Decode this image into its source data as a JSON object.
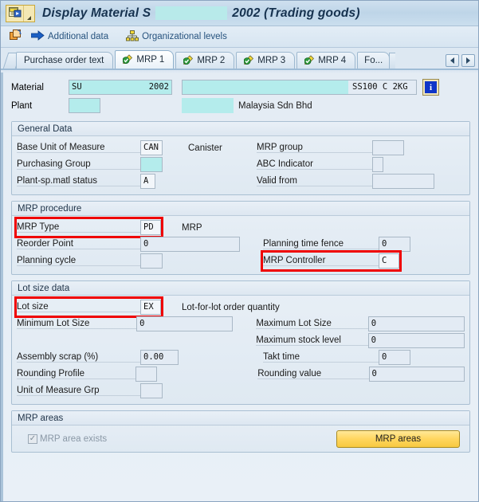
{
  "window": {
    "title_prefix": "Display Material S",
    "title_suffix": "2002 (Trading goods)",
    "sys_menu_icon": "document-arrow-icon",
    "sys_menu_arrow": "dropdown-arrow-icon"
  },
  "toolbar": {
    "items": [
      {
        "icon": "copy-icon",
        "label": ""
      },
      {
        "icon": "arrow-right-icon",
        "label": "Additional data"
      },
      {
        "icon": "org-levels-icon",
        "label": "Organizational levels"
      }
    ]
  },
  "tabs": {
    "items": [
      {
        "label": "Purchase order text",
        "icon": "",
        "active": false
      },
      {
        "label": "MRP 1",
        "icon": "pencil-check-icon",
        "active": true
      },
      {
        "label": "MRP 2",
        "icon": "pencil-check-icon",
        "active": false
      },
      {
        "label": "MRP 3",
        "icon": "pencil-check-icon",
        "active": false
      },
      {
        "label": "MRP 4",
        "icon": "pencil-check-icon",
        "active": false
      },
      {
        "label": "Fo...",
        "icon": "",
        "active": false
      }
    ],
    "nav_prev": "scroll-left-icon",
    "nav_next": "scroll-right-icon"
  },
  "header": {
    "material_label": "Material",
    "material_value_left": "SU",
    "material_value_right": "2002",
    "material_desc": "SS100 C 2KG",
    "info_icon": "info-icon",
    "plant_label": "Plant",
    "plant_value": "",
    "plant_desc": "Malaysia Sdn Bhd"
  },
  "general_data": {
    "title": "General Data",
    "base_uom_label": "Base Unit of Measure",
    "base_uom_value": "CAN",
    "base_uom_text": "Canister",
    "purchasing_group_label": "Purchasing Group",
    "purchasing_group_value": "",
    "plant_sp_status_label": "Plant-sp.matl status",
    "plant_sp_status_value": "A",
    "mrp_group_label": "MRP group",
    "mrp_group_value": "",
    "abc_indicator_label": "ABC Indicator",
    "abc_indicator_value": "",
    "valid_from_label": "Valid from",
    "valid_from_value": ""
  },
  "mrp_procedure": {
    "title": "MRP procedure",
    "mrp_type_label": "MRP Type",
    "mrp_type_value": "PD",
    "mrp_type_text": "MRP",
    "reorder_point_label": "Reorder Point",
    "reorder_point_value": "0",
    "planning_cycle_label": "Planning cycle",
    "planning_cycle_value": "",
    "planning_time_fence_label": "Planning time fence",
    "planning_time_fence_value": "0",
    "mrp_controller_label": "MRP Controller",
    "mrp_controller_value": "C"
  },
  "lot_size_data": {
    "title": "Lot size data",
    "lot_size_label": "Lot size",
    "lot_size_value": "EX",
    "lot_size_text": "Lot-for-lot order quantity",
    "minimum_lot_size_label": "Minimum Lot Size",
    "minimum_lot_size_value": "0",
    "assembly_scrap_label": "Assembly scrap (%)",
    "assembly_scrap_value": "0.00",
    "rounding_profile_label": "Rounding Profile",
    "rounding_profile_value": "",
    "unit_of_measure_grp_label": "Unit of Measure Grp",
    "unit_of_measure_grp_value": "",
    "maximum_lot_size_label": "Maximum Lot Size",
    "maximum_lot_size_value": "0",
    "maximum_stock_level_label": "Maximum stock level",
    "maximum_stock_level_value": "0",
    "takt_time_label": "Takt time",
    "takt_time_value": "0",
    "rounding_value_label": "Rounding value",
    "rounding_value_value": "0"
  },
  "mrp_areas": {
    "title": "MRP areas",
    "checkbox_label": "MRP area exists",
    "checkbox_checked": true,
    "checkbox_glyph": "✓",
    "button_label": "MRP areas"
  },
  "colors": {
    "highlight_box": "#ef0000",
    "redacted": "#b4ecec",
    "button_yellow": "#ffd65e",
    "title_text": "#16324f"
  }
}
